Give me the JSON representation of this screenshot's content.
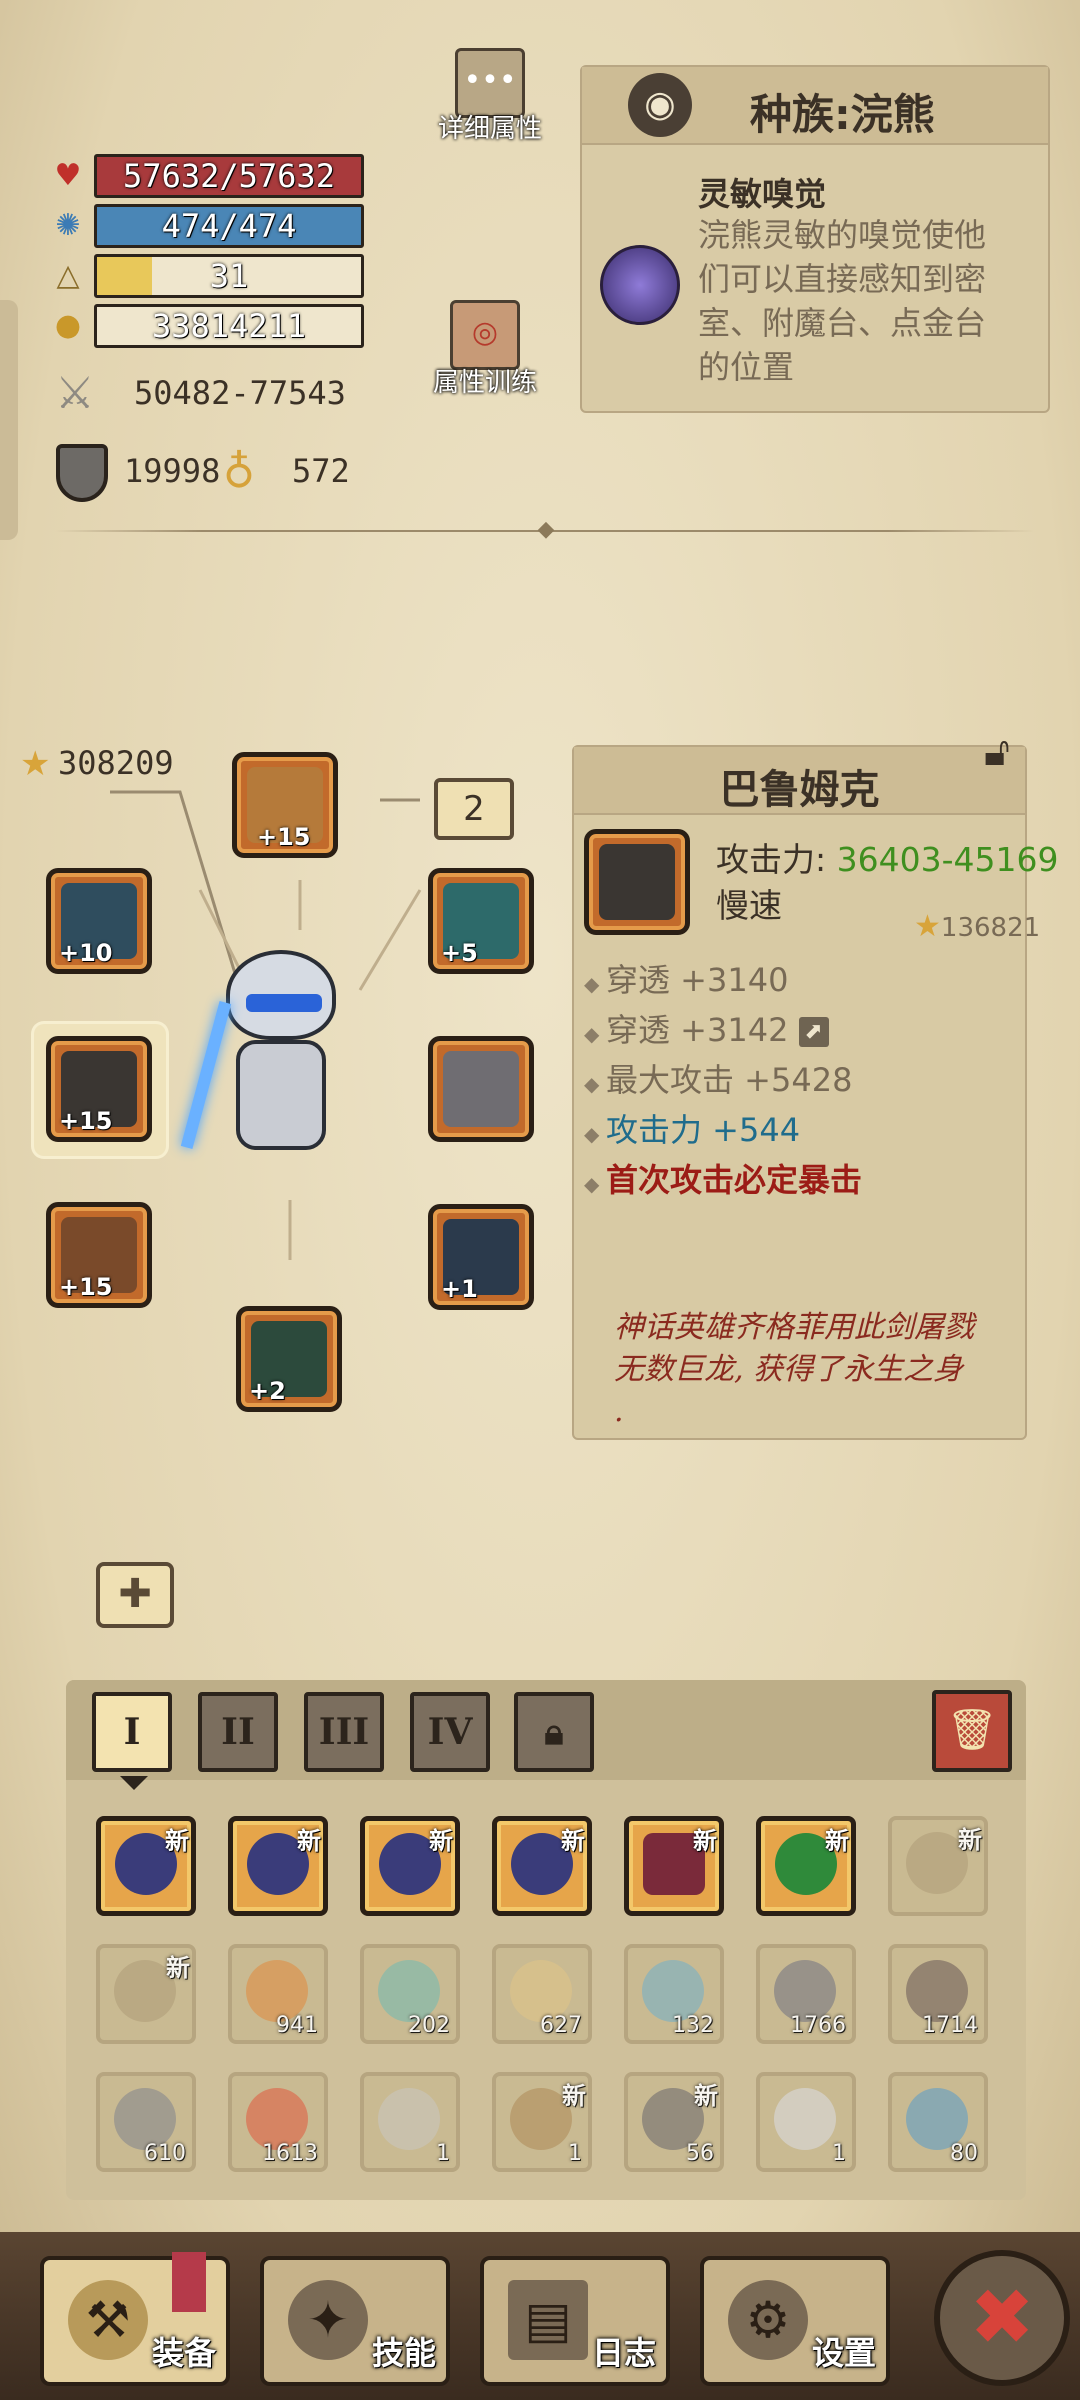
{
  "stats": {
    "hp": "57632/57632",
    "mp": "474/474",
    "level": "31",
    "gold": "33814211",
    "attack_range": "50482-77543",
    "armor": "19998",
    "luck": "572"
  },
  "top_buttons": {
    "details_label": "详细属性",
    "training_label": "属性训练"
  },
  "race": {
    "title": "种族:浣熊",
    "skill_name": "灵敏嗅觉",
    "skill_desc_lines": [
      "浣熊灵敏的嗅觉使他",
      "们可以直接感知到密",
      "室、附魔台、点金台",
      "的位置"
    ]
  },
  "equipment": {
    "total_power": "308209",
    "page_number": "2",
    "slots": {
      "helmet": {
        "enhance": "+15"
      },
      "left_top": {
        "enhance": "+10"
      },
      "weapon": {
        "enhance": "+15"
      },
      "left_bottom": {
        "enhance": "+15"
      },
      "boots": {
        "enhance": "+2"
      },
      "right_top": {
        "enhance": "+5"
      },
      "right_bottom": {
        "enhance": "+1"
      }
    }
  },
  "item": {
    "name": "巴鲁姆克",
    "attack_label": "攻击力: ",
    "attack_value": "36403-45169",
    "speed": "慢速",
    "power": "136821",
    "props": [
      {
        "text": "穿透 +3140",
        "color": "#786a55"
      },
      {
        "text": "穿透 +3142",
        "color": "#786a55"
      },
      {
        "text": "最大攻击 +5428",
        "color": "#786a55"
      },
      {
        "text": "攻击力 +544",
        "color": "#1f6c8c"
      },
      {
        "text": "首次攻击必定暴击",
        "color": "#9c1c16"
      }
    ],
    "flavor_lines": [
      "神话英雄齐格菲用此剑屠戮",
      "无数巨龙, 获得了永生之身",
      "."
    ],
    "colors": {
      "green": "#3f8f1f",
      "blue": "#1f6c8c",
      "red": "#9c1c16"
    }
  },
  "inventory": {
    "tabs": [
      "I",
      "II",
      "III",
      "IV"
    ],
    "new_label": "新",
    "row1": [
      {
        "art": "demon-mask",
        "new": true
      },
      {
        "art": "demon-mask",
        "new": true
      },
      {
        "art": "demon-mask",
        "new": true
      },
      {
        "art": "demon-mask",
        "new": true
      },
      {
        "art": "claw-gauntlet",
        "new": true
      },
      {
        "art": "green-ring",
        "new": true
      },
      {
        "art": "faded-item",
        "new": true
      }
    ],
    "row2": [
      {
        "count": "",
        "new": true
      },
      {
        "count": "941"
      },
      {
        "count": "202"
      },
      {
        "count": "627"
      },
      {
        "count": "132"
      },
      {
        "count": "1766"
      },
      {
        "count": "1714"
      }
    ],
    "row3": [
      {
        "count": "610"
      },
      {
        "count": "1613"
      },
      {
        "count": "1"
      },
      {
        "count": "1",
        "new": true
      },
      {
        "count": "56",
        "new": true
      },
      {
        "count": "1"
      },
      {
        "count": "80"
      }
    ]
  },
  "nav": {
    "equip": "装备",
    "skills": "技能",
    "log": "日志",
    "settings": "设置"
  }
}
